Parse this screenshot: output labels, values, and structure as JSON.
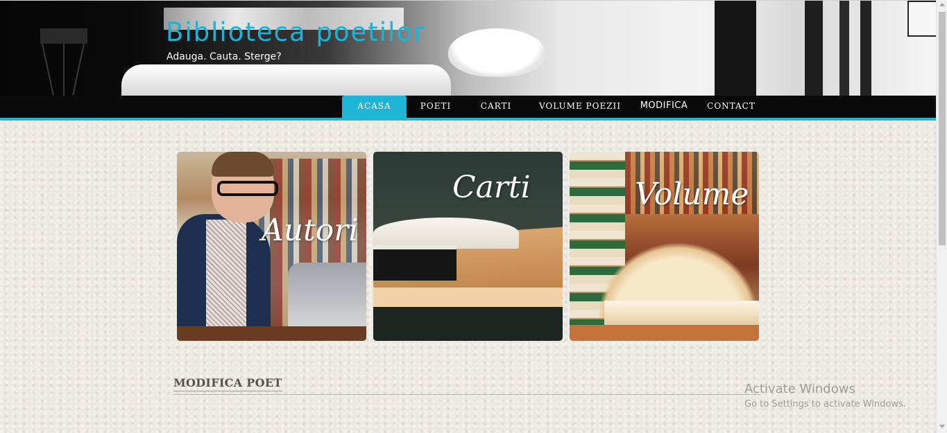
{
  "header": {
    "title": "Biblioteca poetilor",
    "subtitle": "Adauga. Cauta. Sterge?"
  },
  "nav": {
    "items": [
      {
        "label": "ACASA",
        "active": true
      },
      {
        "label": "POETI",
        "active": false
      },
      {
        "label": "CARTI",
        "active": false
      },
      {
        "label": "VOLUME POEZII",
        "active": false
      },
      {
        "label": "MODIFICA",
        "active": false
      },
      {
        "label": "CONTACT",
        "active": false
      }
    ],
    "accent_color": "#1eb6d6"
  },
  "tiles": [
    {
      "label": "Autori"
    },
    {
      "label": "Carti"
    },
    {
      "label": "Volume"
    }
  ],
  "section": {
    "title": "MODIFICA POET"
  },
  "watermark": {
    "title": "Activate Windows",
    "subtitle": "Go to Settings to activate Windows."
  }
}
